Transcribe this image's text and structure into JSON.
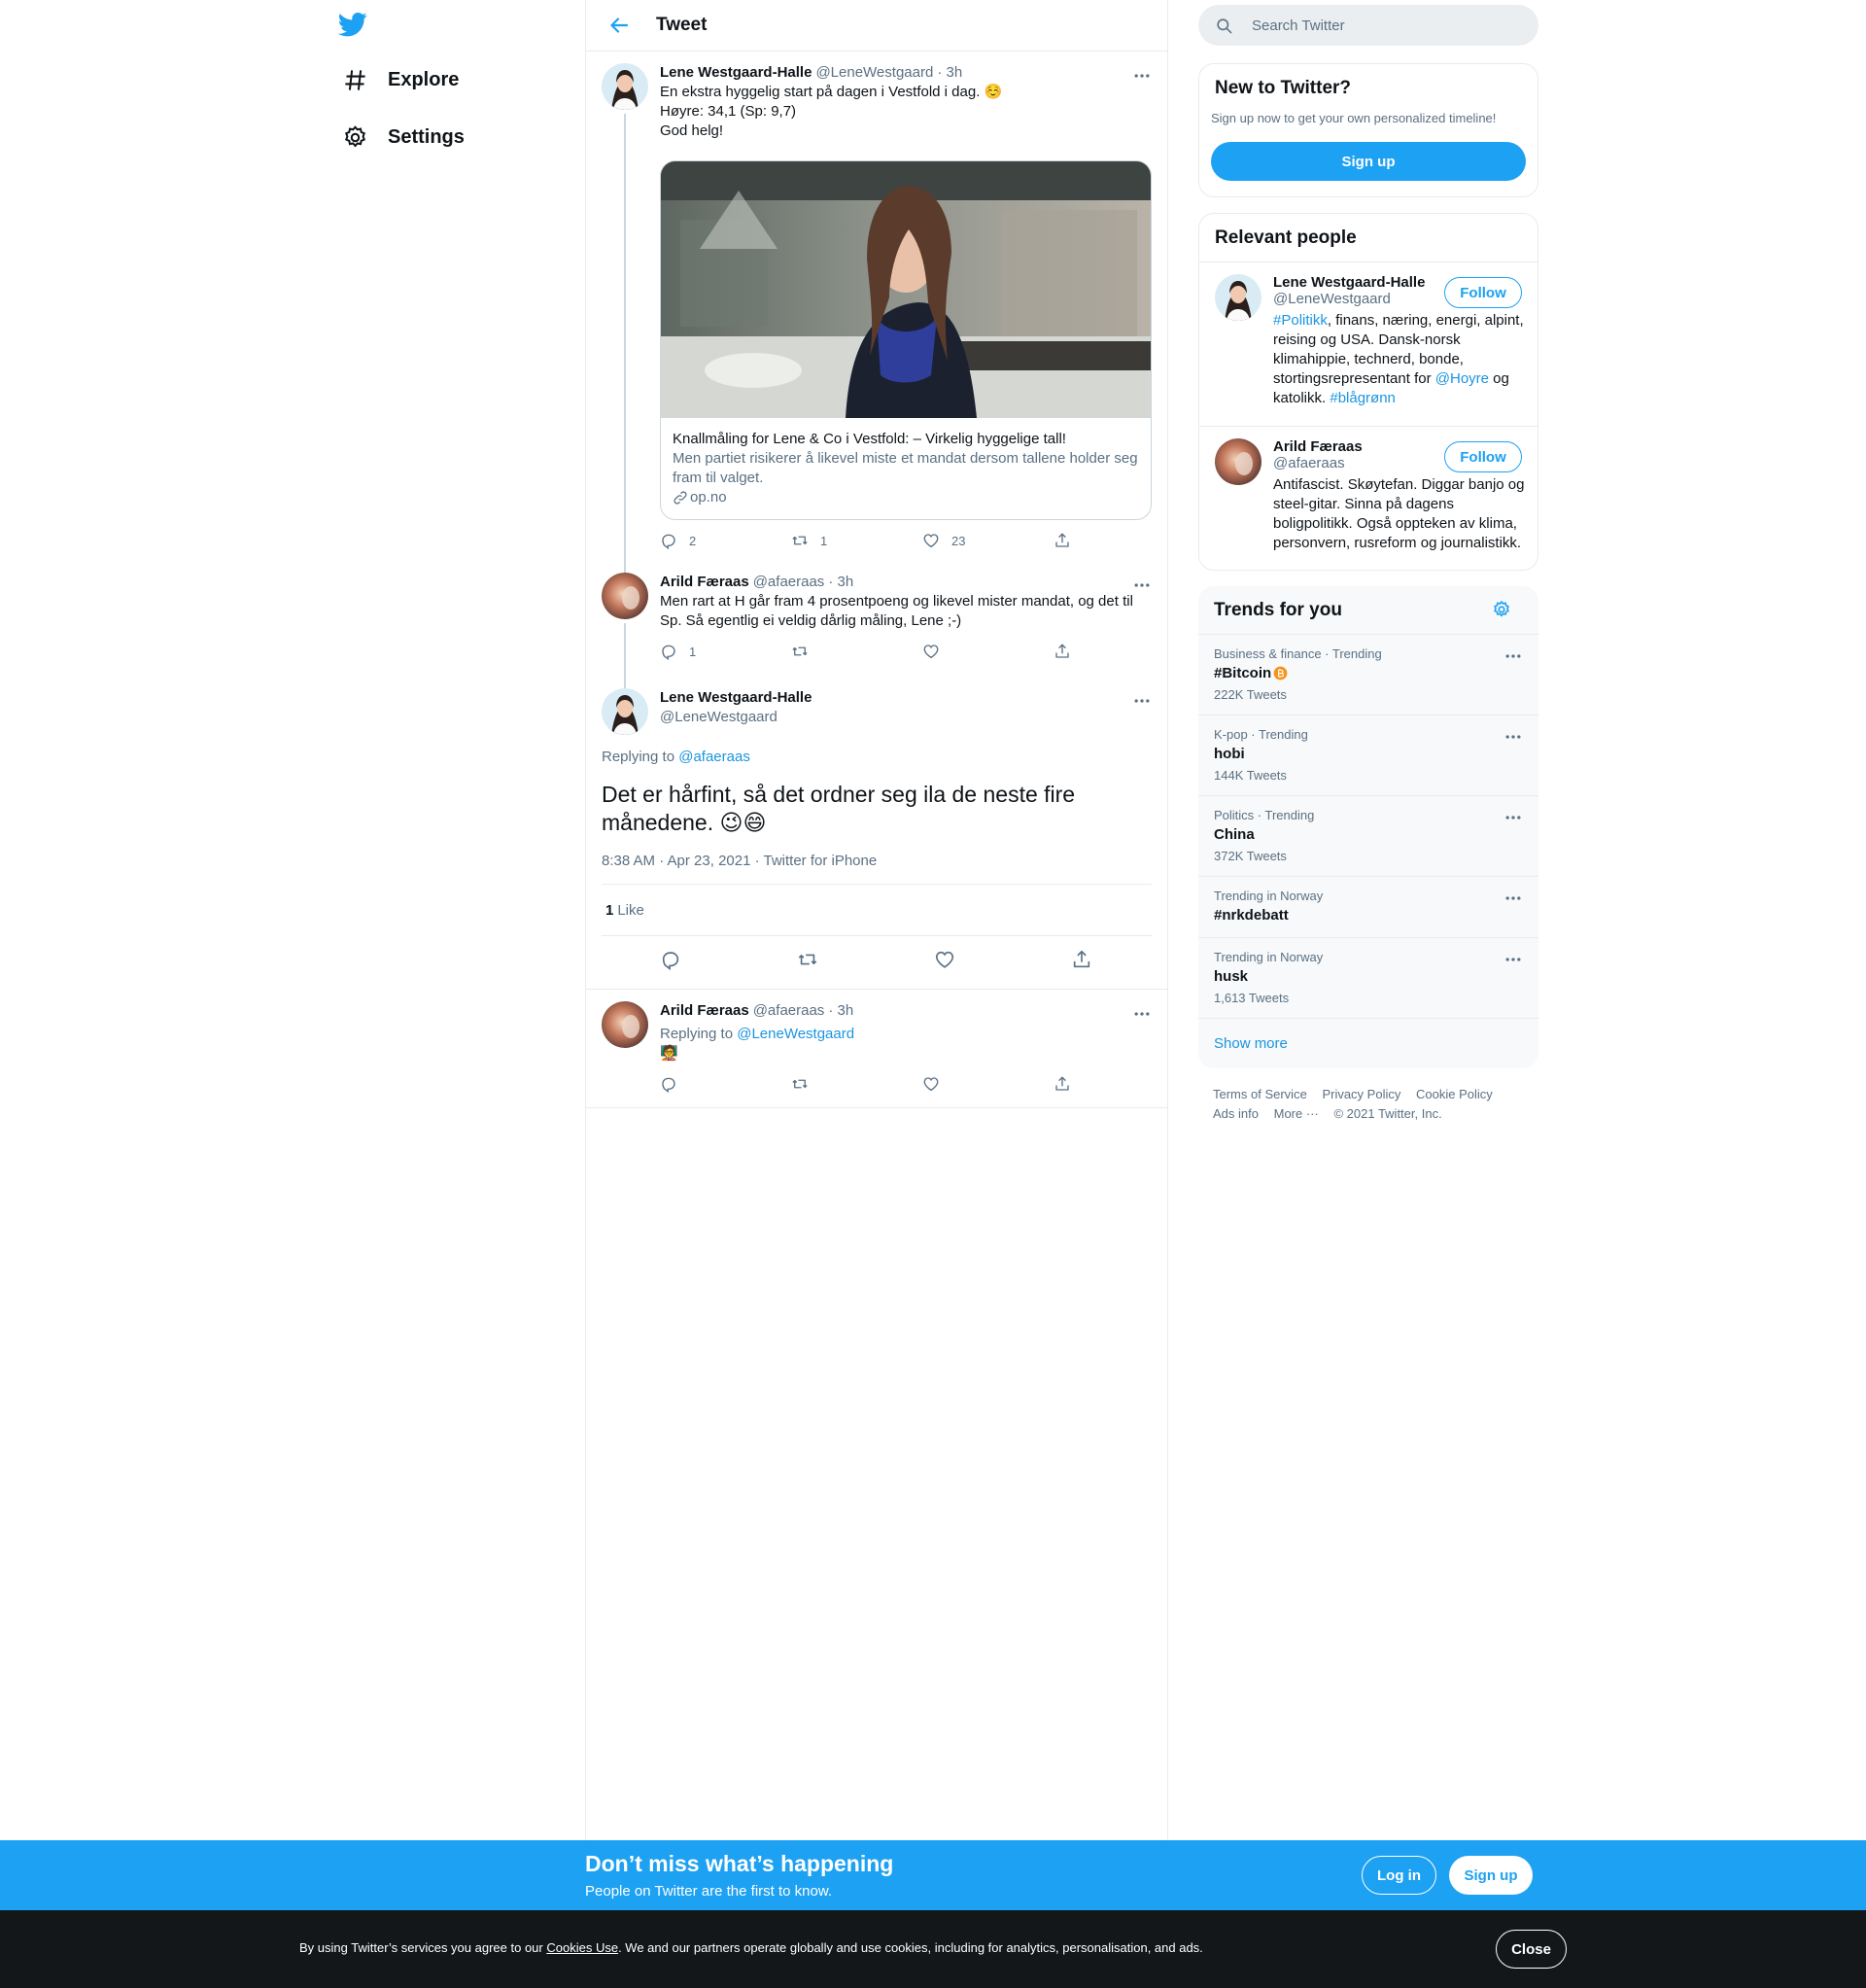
{
  "nav": {
    "explore_label": "Explore",
    "settings_label": "Settings"
  },
  "header": {
    "title": "Tweet"
  },
  "tweets": [
    {
      "name": "Lene Westgaard-Halle",
      "handle": "@LeneWestgaard",
      "time": "· 3h",
      "lines": [
        "En ekstra hyggelig start på dagen i Vestfold i dag. ☺️",
        "Høyre: 34,1 (Sp: 9,7)",
        "God helg!"
      ],
      "card": {
        "title": "Knallmåling for Lene & Co i Vestfold: – Virkelig hyggelige tall!",
        "description": "Men partiet risikerer å likevel miste et mandat dersom tallene holder seg fram til valget.",
        "domain": "op.no"
      },
      "replies": "2",
      "retweets": "1",
      "likes": "23"
    },
    {
      "name": "Arild Færaas",
      "handle": "@afaeraas",
      "time": "· 3h",
      "text": "Men rart at H går fram 4 prosentpoeng og likevel mister mandat, og det til Sp. Så egentlig ei veldig dårlig måling, Lene ;-)",
      "replies": "1"
    }
  ],
  "focus": {
    "name": "Lene Westgaard-Halle",
    "handle": "@LeneWestgaard",
    "replying_prefix": "Replying to",
    "replying_to": "@afaeraas",
    "text": "Det er hårfint, så det ordner seg ila de neste fire månedene. 😉😄",
    "timestamp": "8:38 AM · Apr 23, 2021 · Twitter for iPhone",
    "like_count": "1",
    "like_label": "Like"
  },
  "reply": {
    "name": "Arild Færaas",
    "handle": "@afaeraas",
    "time": "· 3h",
    "replying_prefix": "Replying to",
    "replying_to": "@LeneWestgaard",
    "text": "🧑‍🏫"
  },
  "search": {
    "placeholder": "Search Twitter"
  },
  "new_to_twitter": {
    "title": "New to Twitter?",
    "subtitle": "Sign up now to get your own personalized timeline!",
    "signup_label": "Sign up"
  },
  "relevant": {
    "title": "Relevant people",
    "follow_label": "Follow",
    "people": [
      {
        "name": "Lene Westgaard-Halle",
        "handle": "@LeneWestgaard",
        "bio_parts": [
          "#Politikk",
          ", finans, næring, energi, alpint, reising og USA. Dansk-norsk klimahippie, technerd, bonde, stortingsrepresentant for ",
          "@Hoyre",
          " og katolikk. ",
          "#blågrønn"
        ]
      },
      {
        "name": "Arild Færaas",
        "handle": "@afaeraas",
        "bio": "Antifascist. Skøytefan. Diggar banjo og steel-gitar. Sinna på dagens boligpolitikk. Også oppteken av klima, personvern, rusreform og journalistikk."
      }
    ]
  },
  "trends": {
    "title": "Trends for you",
    "items": [
      {
        "context": "Business & finance · Trending",
        "name": "#Bitcoin",
        "count": "222K Tweets"
      },
      {
        "context": "K-pop · Trending",
        "name": "hobi",
        "count": "144K Tweets"
      },
      {
        "context": "Politics · Trending",
        "name": "China",
        "count": "372K Tweets"
      },
      {
        "context": "Trending in Norway",
        "name": "#nrkdebatt",
        "count": ""
      },
      {
        "context": "Trending in Norway",
        "name": "husk",
        "count": "1,613 Tweets"
      }
    ],
    "show_more": "Show more"
  },
  "footer": {
    "terms": "Terms of Service",
    "privacy": "Privacy Policy",
    "cookie": "Cookie Policy",
    "ads": "Ads info",
    "more": "More ···",
    "copyright": "© 2021 Twitter, Inc."
  },
  "bottom_bar": {
    "title": "Don’t miss what’s happening",
    "subtitle": "People on Twitter are the first to know.",
    "login_label": "Log in",
    "signup_label": "Sign up"
  },
  "cookie_bar": {
    "prefix": "By using Twitter’s services you agree to our ",
    "link": "Cookies Use",
    "suffix": ". We and our partners operate globally and use cookies, including for analytics, personalisation, and ads.",
    "close_label": "Close"
  },
  "colors": {
    "accent": "#1da1f2",
    "text": "#0f1419",
    "muted": "#5b7083",
    "border": "#e6ecf0"
  }
}
